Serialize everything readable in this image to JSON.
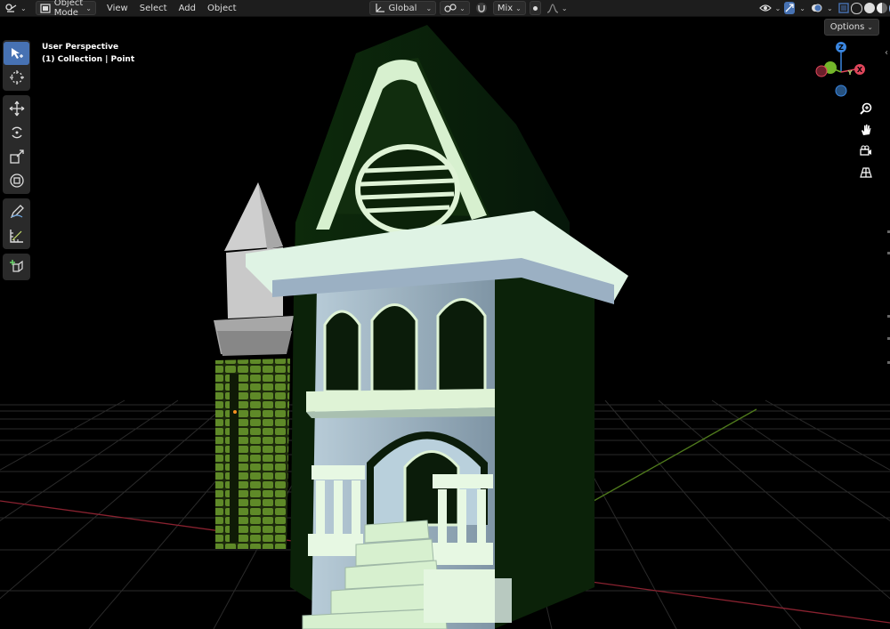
{
  "header": {
    "mode_label": "Object Mode",
    "menus": [
      "View",
      "Select",
      "Add",
      "Object"
    ],
    "transform_orientation": "Global",
    "snap_label": "Mix",
    "options_label": "Options"
  },
  "viewport": {
    "view_name": "User Perspective",
    "collection_info": "(1) Collection | Point"
  },
  "gizmo": {
    "axes": [
      "Z",
      "Y",
      "X"
    ],
    "colors": {
      "x": "#e0465b",
      "y": "#74b62a",
      "z": "#3a86e0"
    }
  },
  "toolbar": {
    "tools": [
      "select-box",
      "cursor",
      "move",
      "rotate",
      "scale",
      "transform",
      "annotate",
      "measure",
      "add-cube"
    ]
  },
  "nav_buttons": [
    "zoom-icon",
    "hand-pan-icon",
    "camera-icon",
    "grid-perspective-icon"
  ],
  "theme": {
    "accent": "#4772b3",
    "header_bg": "#1d1d1d"
  }
}
